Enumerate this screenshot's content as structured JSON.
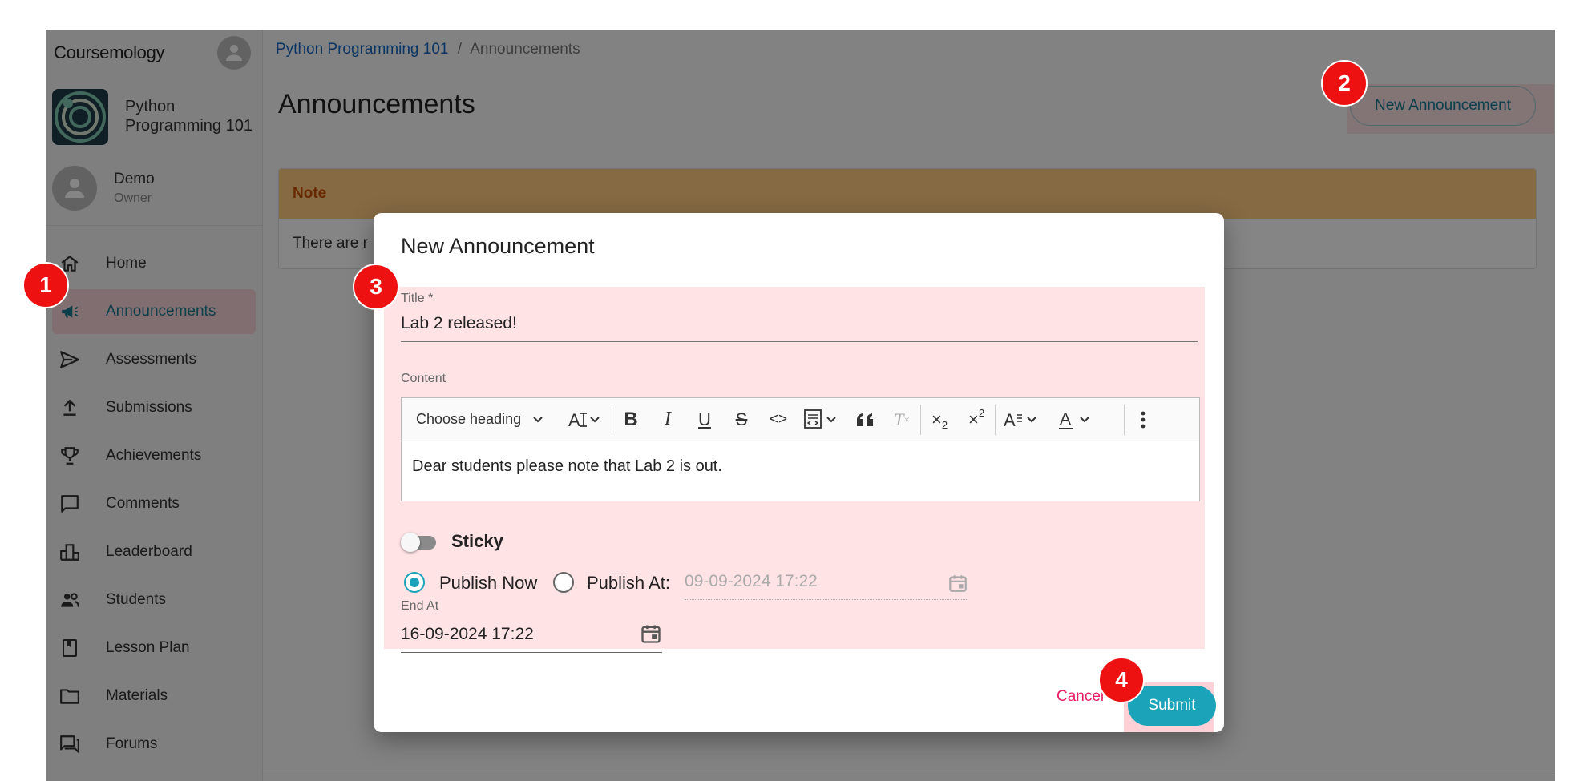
{
  "app": {
    "brand": "Coursemology"
  },
  "course": {
    "name_line1": "Python",
    "name_line2": "Programming 101"
  },
  "user": {
    "name": "Demo",
    "role": "Owner"
  },
  "sidebar": {
    "items": [
      {
        "label": "Home",
        "icon": "home-icon"
      },
      {
        "label": "Announcements",
        "icon": "megaphone-icon"
      },
      {
        "label": "Assessments",
        "icon": "send-icon"
      },
      {
        "label": "Submissions",
        "icon": "upload-icon"
      },
      {
        "label": "Achievements",
        "icon": "trophy-icon"
      },
      {
        "label": "Comments",
        "icon": "comment-icon"
      },
      {
        "label": "Leaderboard",
        "icon": "leaderboard-icon"
      },
      {
        "label": "Students",
        "icon": "people-icon"
      },
      {
        "label": "Lesson Plan",
        "icon": "book-icon"
      },
      {
        "label": "Materials",
        "icon": "folder-icon"
      },
      {
        "label": "Forums",
        "icon": "forum-icon"
      }
    ]
  },
  "breadcrumb": {
    "course": "Python Programming 101",
    "separator": "/",
    "current": "Announcements"
  },
  "page": {
    "title": "Announcements",
    "new_button": "New Announcement"
  },
  "note": {
    "heading": "Note",
    "body": "There are r"
  },
  "dialog": {
    "title": "New Announcement",
    "title_label": "Title *",
    "title_value": "Lab 2 released!",
    "content_label": "Content",
    "heading_select": "Choose heading",
    "content_text": "Dear students please note that Lab 2 is out.",
    "sticky_label": "Sticky",
    "publish_now": "Publish Now",
    "publish_at": "Publish At:",
    "publish_at_value": "09-09-2024 17:22",
    "end_at_label": "End At",
    "end_at_value": "16-09-2024 17:22",
    "cancel": "Cancel",
    "submit": "Submit"
  },
  "steps": [
    "1",
    "2",
    "3",
    "4"
  ],
  "colors": {
    "accent": "#1aa3b9",
    "link": "#1565c0",
    "cancel": "#e91e63",
    "step": "#ee1111",
    "note_head": "#ffcc80"
  }
}
